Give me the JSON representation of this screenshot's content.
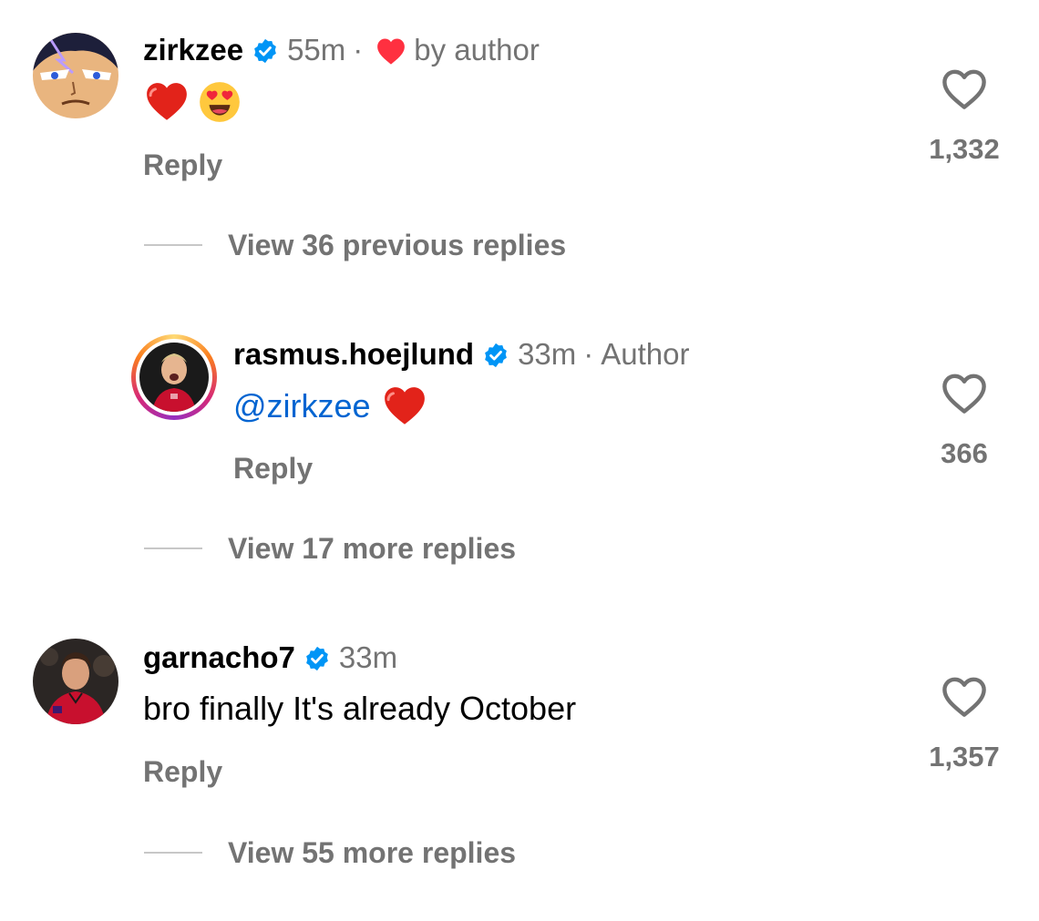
{
  "comments": [
    {
      "username": "zirkzee",
      "verified": true,
      "time": "55m",
      "separator": "·",
      "liked_by_author_label": "by author",
      "body_emojis": [
        "red-heart",
        "heart-eyes"
      ],
      "reply_label": "Reply",
      "like_count": "1,332",
      "view_replies_label": "View 36 previous replies"
    },
    {
      "username": "rasmus.hoejlund",
      "verified": true,
      "time": "33m",
      "separator": "·",
      "author_label": "Author",
      "mention": "@zirkzee",
      "body_emojis": [
        "red-heart"
      ],
      "reply_label": "Reply",
      "like_count": "366",
      "view_replies_label": "View 17 more replies",
      "has_story_ring": true
    },
    {
      "username": "garnacho7",
      "verified": true,
      "time": "33m",
      "body": "bro finally It's already October",
      "reply_label": "Reply",
      "like_count": "1,357",
      "view_replies_label": "View 55 more replies"
    }
  ],
  "colors": {
    "verified_blue": "#0095f6",
    "meta_gray": "#737373",
    "mention_blue": "#0064d1",
    "heart_red": "#ff3040"
  },
  "icons": {
    "verified": "verified-badge-icon",
    "like": "heart-outline-icon",
    "liked_by_author": "heart-filled-icon"
  }
}
